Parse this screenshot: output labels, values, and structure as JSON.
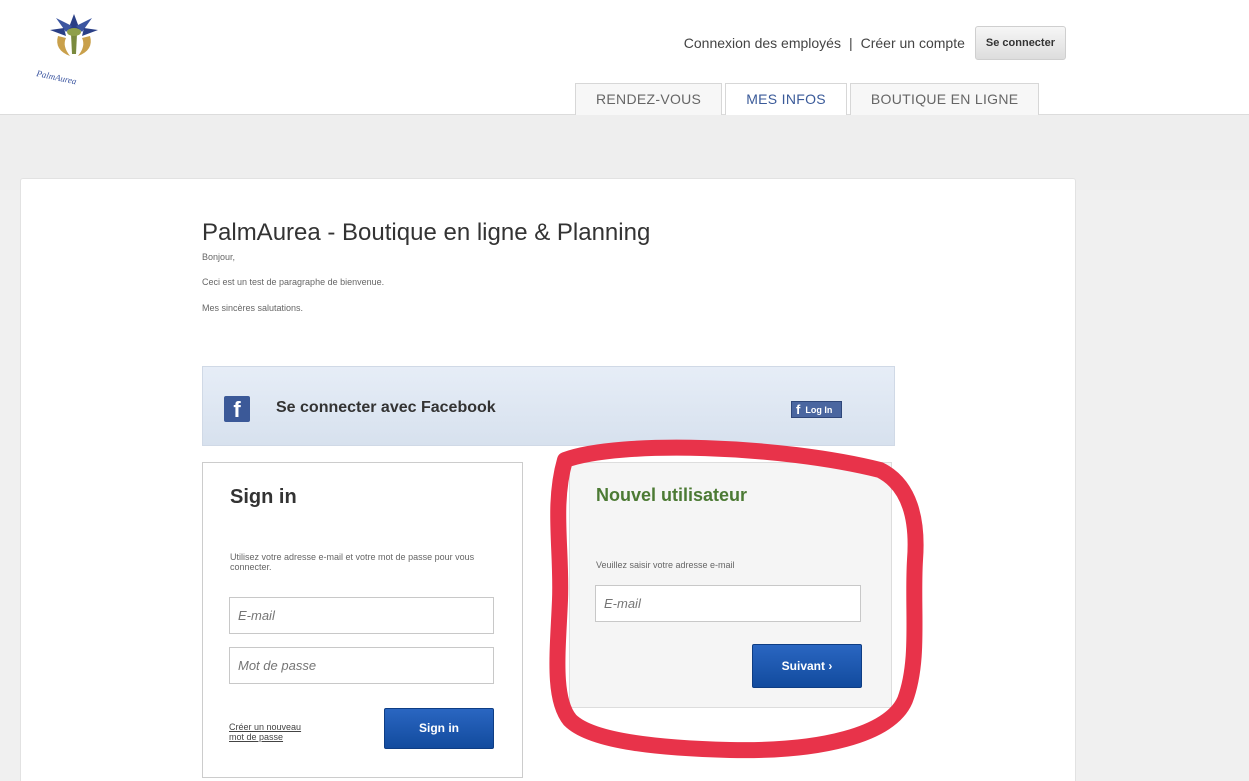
{
  "header": {
    "logo_text": "PalmAurea",
    "topnav": {
      "employee_login": "Connexion des employés",
      "separator": "|",
      "create_account": "Créer un compte",
      "connect_button": "Se connecter"
    },
    "tabs": [
      {
        "label": "RENDEZ-VOUS",
        "active": false
      },
      {
        "label": "MES INFOS",
        "active": true
      },
      {
        "label": "BOUTIQUE EN LIGNE",
        "active": false
      }
    ]
  },
  "main": {
    "title": "PalmAurea - Boutique en ligne & Planning",
    "intro": [
      "Bonjour,",
      "Ceci est un test de paragraphe de bienvenue.",
      "Mes sincères salutations."
    ],
    "facebook": {
      "label": "Se connecter avec Facebook",
      "button_label": "Log In"
    },
    "signin": {
      "title": "Sign in",
      "description": "Utilisez votre adresse e-mail et votre mot de passe pour vous connecter.",
      "email_placeholder": "E-mail",
      "password_placeholder": "Mot de passe",
      "forgot_link": "Créer un nouveau mot de passe",
      "button_label": "Sign in"
    },
    "newuser": {
      "title": "Nouvel utilisateur",
      "description": "Veuillez saisir votre adresse e-mail",
      "email_placeholder": "E-mail",
      "button_label": "Suivant ›"
    }
  },
  "colors": {
    "accent_blue": "#124b9e",
    "facebook_blue": "#3b5998",
    "newuser_green": "#4c7a34",
    "annotation_red": "#e8334a"
  }
}
